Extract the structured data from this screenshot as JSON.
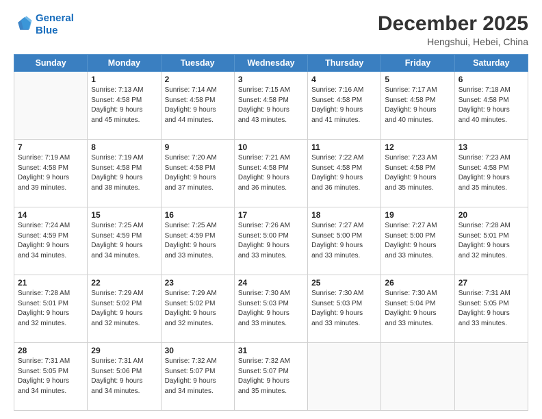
{
  "header": {
    "logo_line1": "General",
    "logo_line2": "Blue",
    "main_title": "December 2025",
    "sub_title": "Hengshui, Hebei, China"
  },
  "days_of_week": [
    "Sunday",
    "Monday",
    "Tuesday",
    "Wednesday",
    "Thursday",
    "Friday",
    "Saturday"
  ],
  "weeks": [
    [
      {
        "day": "",
        "info": ""
      },
      {
        "day": "1",
        "info": "Sunrise: 7:13 AM\nSunset: 4:58 PM\nDaylight: 9 hours\nand 45 minutes."
      },
      {
        "day": "2",
        "info": "Sunrise: 7:14 AM\nSunset: 4:58 PM\nDaylight: 9 hours\nand 44 minutes."
      },
      {
        "day": "3",
        "info": "Sunrise: 7:15 AM\nSunset: 4:58 PM\nDaylight: 9 hours\nand 43 minutes."
      },
      {
        "day": "4",
        "info": "Sunrise: 7:16 AM\nSunset: 4:58 PM\nDaylight: 9 hours\nand 41 minutes."
      },
      {
        "day": "5",
        "info": "Sunrise: 7:17 AM\nSunset: 4:58 PM\nDaylight: 9 hours\nand 40 minutes."
      },
      {
        "day": "6",
        "info": "Sunrise: 7:18 AM\nSunset: 4:58 PM\nDaylight: 9 hours\nand 40 minutes."
      }
    ],
    [
      {
        "day": "7",
        "info": "Sunrise: 7:19 AM\nSunset: 4:58 PM\nDaylight: 9 hours\nand 39 minutes."
      },
      {
        "day": "8",
        "info": "Sunrise: 7:19 AM\nSunset: 4:58 PM\nDaylight: 9 hours\nand 38 minutes."
      },
      {
        "day": "9",
        "info": "Sunrise: 7:20 AM\nSunset: 4:58 PM\nDaylight: 9 hours\nand 37 minutes."
      },
      {
        "day": "10",
        "info": "Sunrise: 7:21 AM\nSunset: 4:58 PM\nDaylight: 9 hours\nand 36 minutes."
      },
      {
        "day": "11",
        "info": "Sunrise: 7:22 AM\nSunset: 4:58 PM\nDaylight: 9 hours\nand 36 minutes."
      },
      {
        "day": "12",
        "info": "Sunrise: 7:23 AM\nSunset: 4:58 PM\nDaylight: 9 hours\nand 35 minutes."
      },
      {
        "day": "13",
        "info": "Sunrise: 7:23 AM\nSunset: 4:58 PM\nDaylight: 9 hours\nand 35 minutes."
      }
    ],
    [
      {
        "day": "14",
        "info": "Sunrise: 7:24 AM\nSunset: 4:59 PM\nDaylight: 9 hours\nand 34 minutes."
      },
      {
        "day": "15",
        "info": "Sunrise: 7:25 AM\nSunset: 4:59 PM\nDaylight: 9 hours\nand 34 minutes."
      },
      {
        "day": "16",
        "info": "Sunrise: 7:25 AM\nSunset: 4:59 PM\nDaylight: 9 hours\nand 33 minutes."
      },
      {
        "day": "17",
        "info": "Sunrise: 7:26 AM\nSunset: 5:00 PM\nDaylight: 9 hours\nand 33 minutes."
      },
      {
        "day": "18",
        "info": "Sunrise: 7:27 AM\nSunset: 5:00 PM\nDaylight: 9 hours\nand 33 minutes."
      },
      {
        "day": "19",
        "info": "Sunrise: 7:27 AM\nSunset: 5:00 PM\nDaylight: 9 hours\nand 33 minutes."
      },
      {
        "day": "20",
        "info": "Sunrise: 7:28 AM\nSunset: 5:01 PM\nDaylight: 9 hours\nand 32 minutes."
      }
    ],
    [
      {
        "day": "21",
        "info": "Sunrise: 7:28 AM\nSunset: 5:01 PM\nDaylight: 9 hours\nand 32 minutes."
      },
      {
        "day": "22",
        "info": "Sunrise: 7:29 AM\nSunset: 5:02 PM\nDaylight: 9 hours\nand 32 minutes."
      },
      {
        "day": "23",
        "info": "Sunrise: 7:29 AM\nSunset: 5:02 PM\nDaylight: 9 hours\nand 32 minutes."
      },
      {
        "day": "24",
        "info": "Sunrise: 7:30 AM\nSunset: 5:03 PM\nDaylight: 9 hours\nand 33 minutes."
      },
      {
        "day": "25",
        "info": "Sunrise: 7:30 AM\nSunset: 5:03 PM\nDaylight: 9 hours\nand 33 minutes."
      },
      {
        "day": "26",
        "info": "Sunrise: 7:30 AM\nSunset: 5:04 PM\nDaylight: 9 hours\nand 33 minutes."
      },
      {
        "day": "27",
        "info": "Sunrise: 7:31 AM\nSunset: 5:05 PM\nDaylight: 9 hours\nand 33 minutes."
      }
    ],
    [
      {
        "day": "28",
        "info": "Sunrise: 7:31 AM\nSunset: 5:05 PM\nDaylight: 9 hours\nand 34 minutes."
      },
      {
        "day": "29",
        "info": "Sunrise: 7:31 AM\nSunset: 5:06 PM\nDaylight: 9 hours\nand 34 minutes."
      },
      {
        "day": "30",
        "info": "Sunrise: 7:32 AM\nSunset: 5:07 PM\nDaylight: 9 hours\nand 34 minutes."
      },
      {
        "day": "31",
        "info": "Sunrise: 7:32 AM\nSunset: 5:07 PM\nDaylight: 9 hours\nand 35 minutes."
      },
      {
        "day": "",
        "info": ""
      },
      {
        "day": "",
        "info": ""
      },
      {
        "day": "",
        "info": ""
      }
    ]
  ]
}
